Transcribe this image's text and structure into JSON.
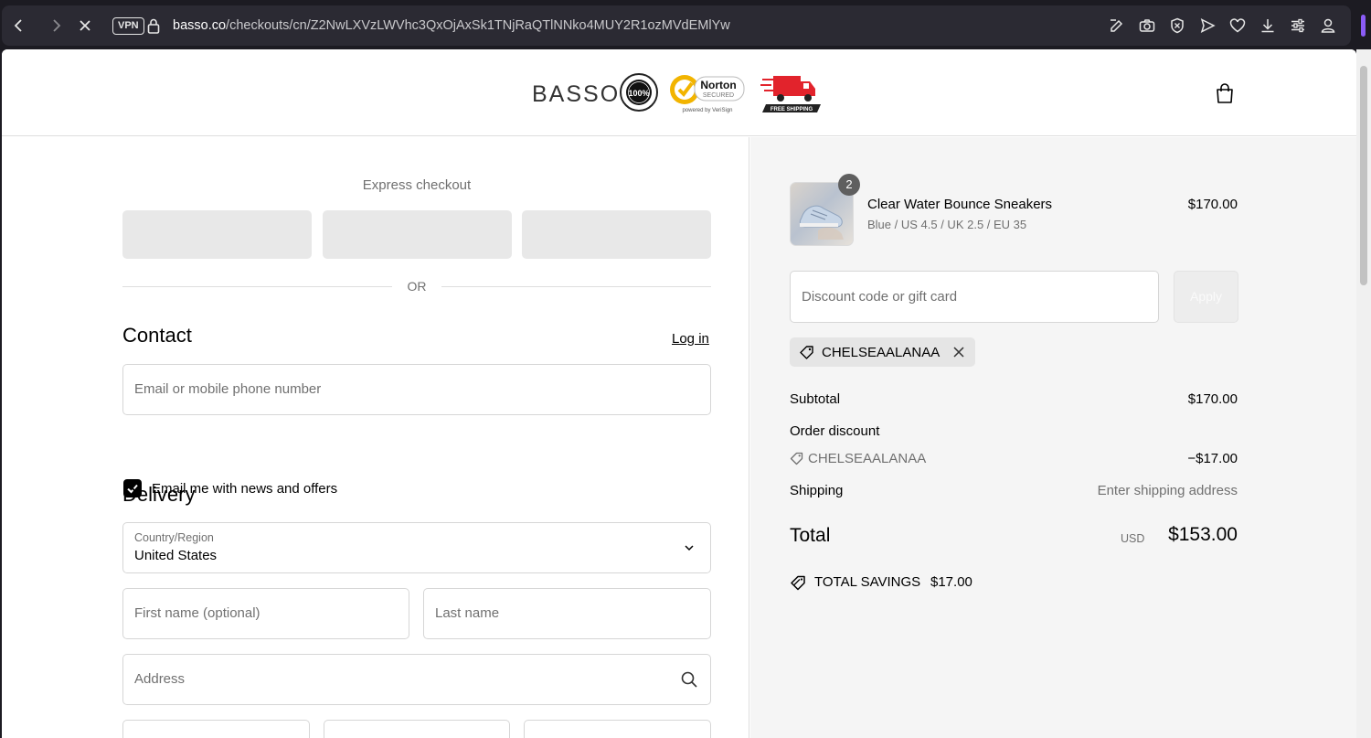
{
  "browser": {
    "vpn_label": "VPN",
    "url_host": "basso.co",
    "url_path": "/checkouts/cn/Z2NwLXVzLWVhc3QxOjAxSk1TNjRaQTlNNko4MUY2R1ozMVdEMlYw"
  },
  "header": {
    "logo": "BASSO",
    "badges": {
      "satisfaction": "100%",
      "satisfaction_ring": "SATISFACTION GUARANTEED",
      "norton": "Norton",
      "norton_sub": "SECURED",
      "norton_powered": "powered by VeriSign",
      "shipping": "FREE SHIPPING"
    }
  },
  "express": {
    "title": "Express checkout",
    "or": "OR"
  },
  "contact": {
    "title": "Contact",
    "login": "Log in",
    "email_placeholder": "Email or mobile phone number",
    "news_checkbox_label": "Email me with news and offers",
    "news_checked": true
  },
  "delivery": {
    "title": "Delivery",
    "country_label": "Country/Region",
    "country_value": "United States",
    "first_name_placeholder": "First name (optional)",
    "last_name_placeholder": "Last name",
    "address_placeholder": "Address"
  },
  "order": {
    "product": {
      "quantity": "2",
      "name": "Clear Water Bounce Sneakers",
      "variant": "Blue / US 4.5 / UK 2.5 / EU 35",
      "price": "$170.00"
    },
    "discount_placeholder": "Discount code or gift card",
    "apply_label": "Apply",
    "applied_code": "CHELSEAALANAA",
    "subtotal_label": "Subtotal",
    "subtotal_value": "$170.00",
    "order_discount_label": "Order discount",
    "discount_code": "CHELSEAALANAA",
    "discount_value": "−$17.00",
    "shipping_label": "Shipping",
    "shipping_value": "Enter shipping address",
    "total_label": "Total",
    "total_currency": "USD",
    "total_value": "$153.00",
    "savings_label": "TOTAL SAVINGS",
    "savings_value": "$17.00"
  },
  "colors": {
    "accent": "#8b5cf6",
    "right_bg": "#f5f5f5",
    "browser_bg": "#1c1b22"
  }
}
